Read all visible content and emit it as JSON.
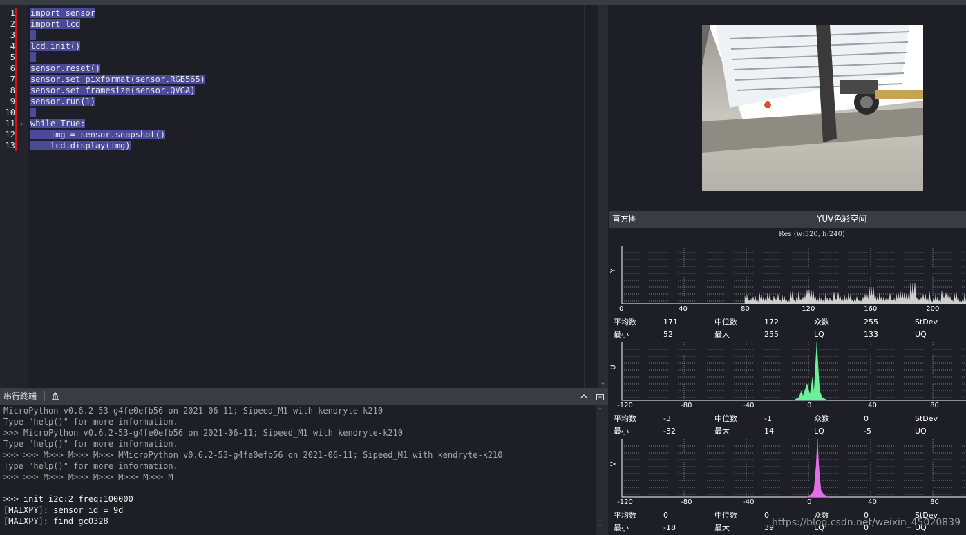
{
  "editor": {
    "lines": [
      {
        "no": "1",
        "text": "import sensor"
      },
      {
        "no": "2",
        "text": "import lcd"
      },
      {
        "no": "3",
        "text": ""
      },
      {
        "no": "4",
        "text": "lcd.init()"
      },
      {
        "no": "5",
        "text": ""
      },
      {
        "no": "6",
        "text": "sensor.reset()"
      },
      {
        "no": "7",
        "text": "sensor.set_pixformat(sensor.RGB565)"
      },
      {
        "no": "8",
        "text": "sensor.set_framesize(sensor.QVGA)"
      },
      {
        "no": "9",
        "text": "sensor.run(1)"
      },
      {
        "no": "10",
        "text": ""
      },
      {
        "no": "11",
        "text": "while True:"
      },
      {
        "no": "12",
        "text": "    img = sensor.snapshot()"
      },
      {
        "no": "13",
        "text": "    lcd.display(img)"
      }
    ]
  },
  "terminal": {
    "title": "串行终端",
    "lines": [
      "MicroPython v0.6.2-53-g4fe0efb56 on 2021-06-11; Sipeed_M1 with kendryte-k210",
      "Type \"help()\" for more information.",
      ">>> MicroPython v0.6.2-53-g4fe0efb56 on 2021-06-11; Sipeed_M1 with kendryte-k210",
      "Type \"help()\" for more information.",
      ">>> >>> M>>> M>>> M>>> MMicroPython v0.6.2-53-g4fe0efb56 on 2021-06-11; Sipeed_M1 with kendryte-k210",
      "Type \"help()\" for more information.",
      ">>> >>> M>>> M>>> M>>> M>>> M>>> M",
      "",
      ">>> init i2c:2 freq:100000",
      "[MAIXPY]: sensor id = 9d",
      "[MAIXPY]: find gc0328"
    ]
  },
  "histogram": {
    "title": "直方图",
    "colorspace": "YUV色彩空间",
    "resolution": "Res (w:320, h:240)",
    "channels": [
      {
        "axis": "Y",
        "color": "#cfcfcf",
        "ticks": [
          "0",
          "40",
          "80",
          "120",
          "160",
          "200"
        ],
        "stats": {
          "mean_label": "平均数",
          "mean": "171",
          "median_label": "中位数",
          "median": "172",
          "mode_label": "众数",
          "mode": "255",
          "stdev_label": "StDev",
          "min_label": "最小",
          "min": "52",
          "max_label": "最大",
          "max": "255",
          "lq_label": "LQ",
          "lq": "133",
          "uq_label": "UQ"
        }
      },
      {
        "axis": "U",
        "color": "#6df09a",
        "ticks": [
          "-120",
          "-80",
          "-40",
          "0",
          "40",
          "80"
        ],
        "stats": {
          "mean_label": "平均数",
          "mean": "-3",
          "median_label": "中位数",
          "median": "-1",
          "mode_label": "众数",
          "mode": "0",
          "stdev_label": "StDev",
          "min_label": "最小",
          "min": "-32",
          "max_label": "最大",
          "max": "14",
          "lq_label": "LQ",
          "lq": "-5",
          "uq_label": "UQ"
        }
      },
      {
        "axis": "V",
        "color": "#e070e8",
        "ticks": [
          "-120",
          "-80",
          "-40",
          "0",
          "40",
          "80"
        ],
        "stats": {
          "mean_label": "平均数",
          "mean": "0",
          "median_label": "中位数",
          "median": "0",
          "mode_label": "众数",
          "mode": "0",
          "stdev_label": "StDev",
          "min_label": "最小",
          "min": "-18",
          "max_label": "最大",
          "max": "39",
          "lq_label": "LQ",
          "lq": "0",
          "uq_label": "UQ"
        }
      }
    ]
  },
  "watermark": "https://blog.csdn.net/weixin_45020839"
}
